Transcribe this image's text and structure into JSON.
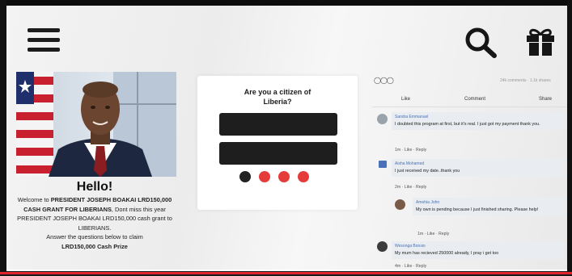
{
  "header": {
    "menu_icon": "hamburger-menu-icon",
    "search_icon": "search-icon",
    "gift_icon": "gift-icon"
  },
  "promo": {
    "title": "Hello!",
    "line1": "Welcome to ",
    "line1_bold": "PRESIDENT JOSEPH BOAKAI LRD150,000 CASH GRANT FOR LIBERIANS",
    "line2": ", Dont miss this year PRESIDENT JOSEPH BOAKAI LRD150,000 cash grant to LIBERIANS.",
    "line3": "Answer the questions below to claim",
    "line3_bold": "LRD150,000 Cash Prize"
  },
  "quiz": {
    "question": "Are you a citizen of Liberia?",
    "progress_step": 1,
    "progress_total": 4
  },
  "comments": {
    "count_text": "24k comments · 1.1k shares",
    "actions": {
      "like": "Like",
      "comment": "Comment",
      "share": "Share"
    },
    "items": [
      {
        "name": "Sandra Emmanuel",
        "text": "I doubted this program at first, but it's real. I just got my payment thank you.",
        "meta": "1m · Like · Reply"
      },
      {
        "name": "Aisha Mohamed",
        "text": "I just received my date..thank you",
        "meta": "2m · Like · Reply"
      },
      {
        "name": "Amohia John",
        "text": "My own is pending because I just finished sharing. Please help!",
        "meta": "1m · Like · Reply"
      },
      {
        "name": "Wesonga Bonsio",
        "text": "My mum has recieved 250000 already, I pray i get too",
        "meta": "4m · Like · Reply"
      }
    ]
  },
  "colors": {
    "accent_red": "#e63b3b",
    "dark": "#1e1e1e",
    "link_blue": "#4a72b8"
  }
}
